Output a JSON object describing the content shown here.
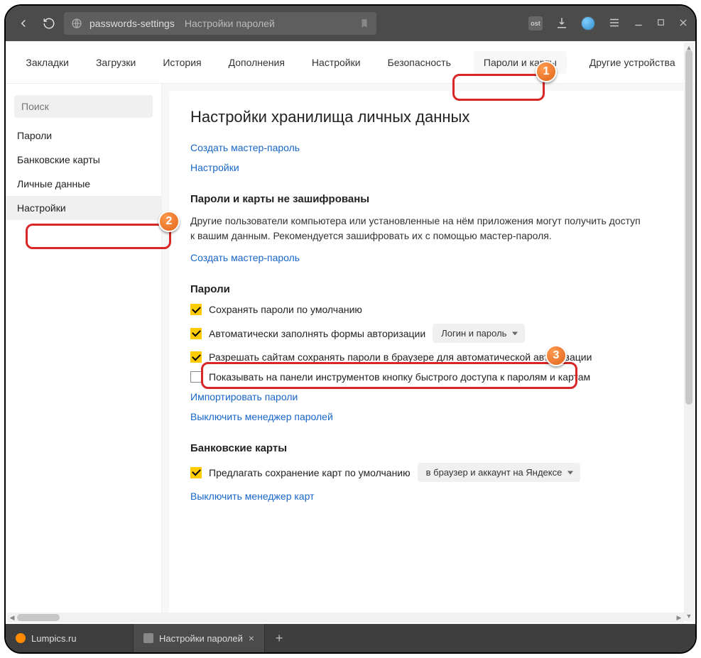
{
  "titlebar": {
    "url": "passwords-settings",
    "page_title": "Настройки паролей"
  },
  "topnav": {
    "bookmarks": "Закладки",
    "downloads": "Загрузки",
    "history": "История",
    "addons": "Дополнения",
    "settings": "Настройки",
    "security": "Безопасность",
    "passwords_cards": "Пароли и карты",
    "other_devices": "Другие устройства"
  },
  "sidebar": {
    "search_placeholder": "Поиск",
    "passwords": "Пароли",
    "bank_cards": "Банковские карты",
    "personal_data": "Личные данные",
    "settings": "Настройки"
  },
  "content": {
    "heading": "Настройки хранилища личных данных",
    "create_master": "Создать мастер-пароль",
    "settings_link": "Настройки",
    "not_encrypted_title": "Пароли и карты не зашифрованы",
    "not_encrypted_desc": "Другие пользователи компьютера или установленные на нём приложения могут получить доступ к вашим данным. Рекомендуется зашифровать их с помощью мастер-пароля.",
    "create_master2": "Создать мастер-пароль",
    "passwords_title": "Пароли",
    "cb_save_default": "Сохранять пароли по умолчанию",
    "cb_autofill": "Автоматически заполнять формы авторизации",
    "autofill_mode": "Логин и пароль",
    "cb_allow_sites": "Разрешать сайтам сохранять пароли в браузере для автоматической авторизации",
    "cb_show_panel": "Показывать на панели инструментов кнопку быстрого доступа к паролям и картам",
    "import_passwords": "Импортировать пароли",
    "disable_pw_manager": "Выключить менеджер паролей",
    "cards_title": "Банковские карты",
    "cb_offer_save_cards": "Предлагать сохранение карт по умолчанию",
    "cards_mode": "в браузер и аккаунт на Яндексе",
    "disable_card_manager": "Выключить менеджер карт"
  },
  "tabs": {
    "tab1": "Lumpics.ru",
    "tab2": "Настройки паролей"
  }
}
